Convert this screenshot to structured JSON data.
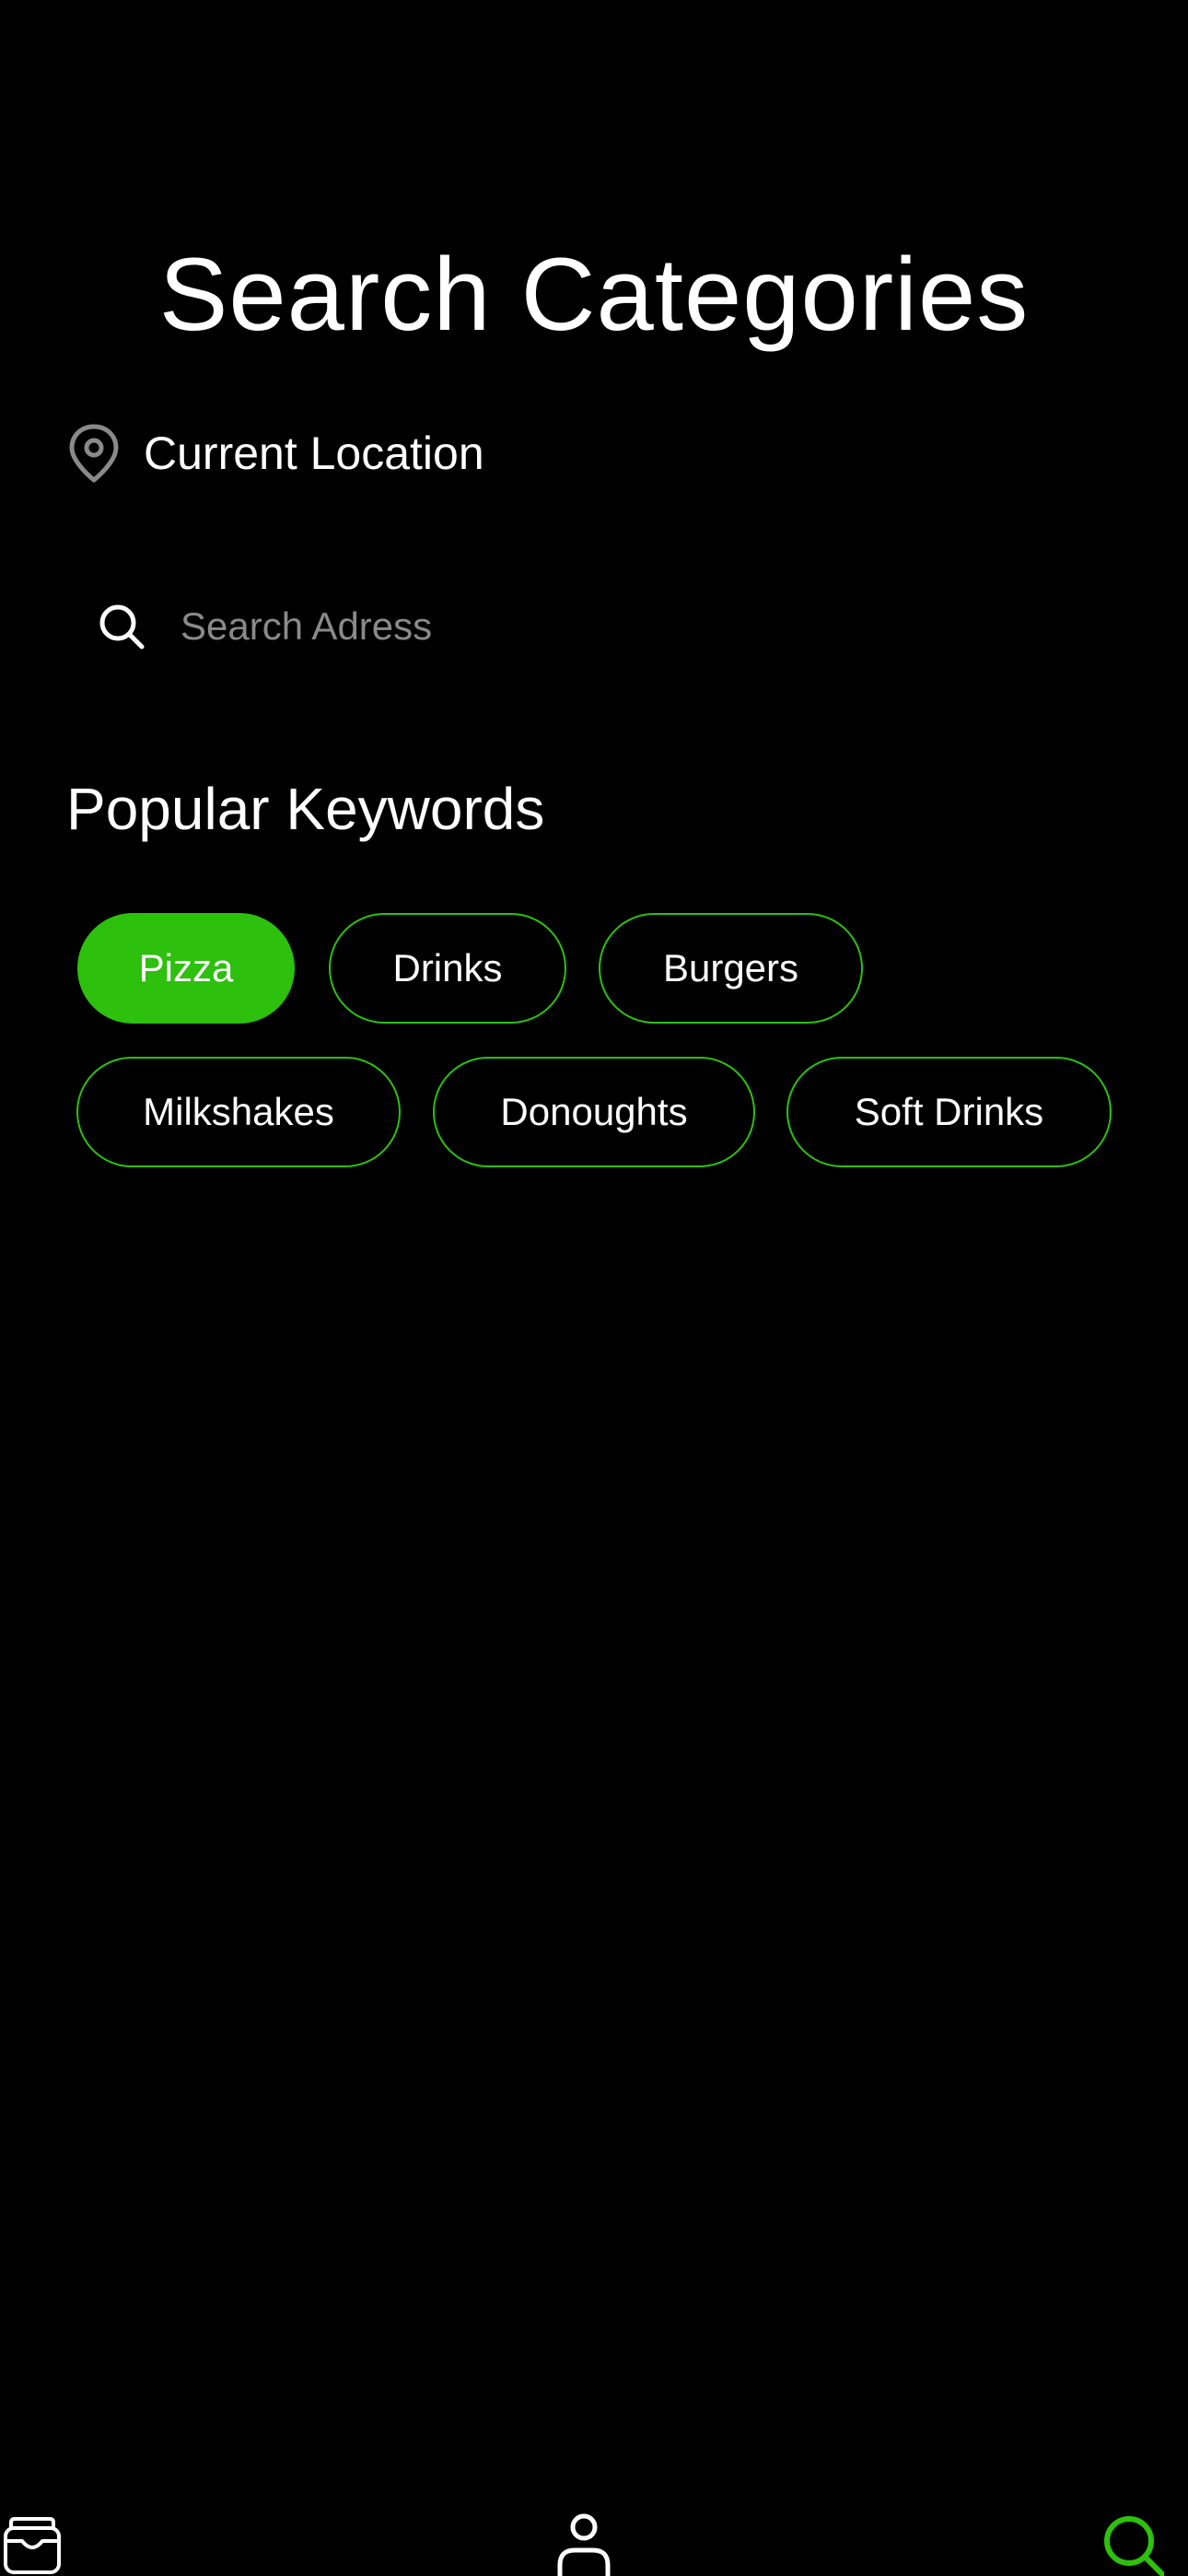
{
  "header": {
    "title": "Search Categories"
  },
  "location": {
    "icon": "location-pin-icon",
    "label": "Current Location"
  },
  "search": {
    "icon": "search-icon",
    "value": "",
    "placeholder": "Search Adress"
  },
  "keywords": {
    "title": "Popular Keywords",
    "items": [
      {
        "label": "Pizza",
        "selected": true
      },
      {
        "label": "Drinks",
        "selected": false
      },
      {
        "label": "Burgers",
        "selected": false
      },
      {
        "label": "Milkshakes",
        "selected": false
      },
      {
        "label": "Donoughts",
        "selected": false
      },
      {
        "label": "Soft Drinks",
        "selected": false
      }
    ]
  },
  "bottom_nav": {
    "items": [
      {
        "icon": "wallet-icon",
        "active": false
      },
      {
        "icon": "profile-icon",
        "active": false
      },
      {
        "icon": "search-icon",
        "active": true
      }
    ]
  },
  "colors": {
    "background": "#000000",
    "accent": "#2dc00d",
    "text": "#ffffff",
    "muted": "#8a8a8a"
  }
}
